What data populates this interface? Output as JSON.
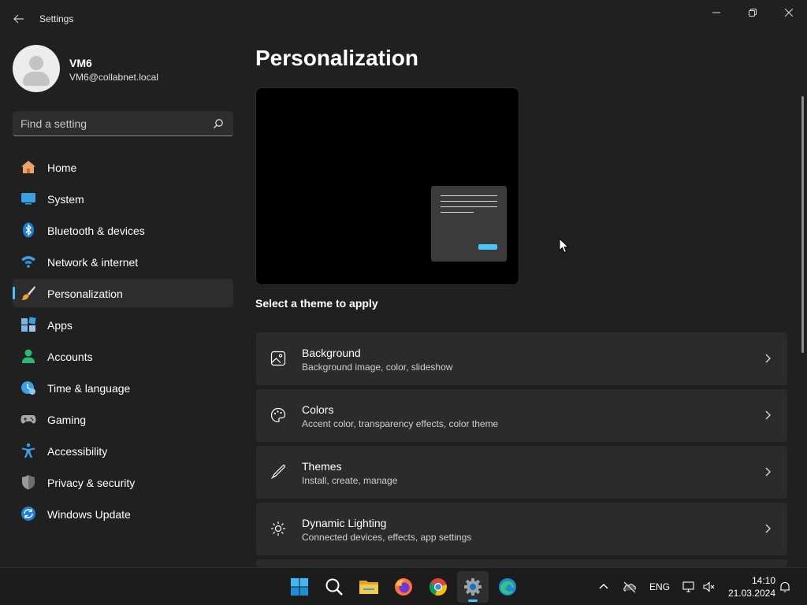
{
  "window": {
    "title": "Settings",
    "controls": {
      "minimize": "minimize-icon",
      "maximize": "restore-icon",
      "close": "close-icon"
    }
  },
  "user": {
    "name": "VM6",
    "email": "VM6@collabnet.local"
  },
  "search": {
    "placeholder": "Find a setting",
    "value": ""
  },
  "sidebar": {
    "items": [
      {
        "label": "Home",
        "icon": "home-icon",
        "active": false
      },
      {
        "label": "System",
        "icon": "system-icon",
        "active": false
      },
      {
        "label": "Bluetooth & devices",
        "icon": "bluetooth-icon",
        "active": false
      },
      {
        "label": "Network & internet",
        "icon": "network-icon",
        "active": false
      },
      {
        "label": "Personalization",
        "icon": "brush-icon",
        "active": true
      },
      {
        "label": "Apps",
        "icon": "apps-icon",
        "active": false
      },
      {
        "label": "Accounts",
        "icon": "accounts-icon",
        "active": false
      },
      {
        "label": "Time & language",
        "icon": "time-icon",
        "active": false
      },
      {
        "label": "Gaming",
        "icon": "gamepad-icon",
        "active": false
      },
      {
        "label": "Accessibility",
        "icon": "accessibility-icon",
        "active": false
      },
      {
        "label": "Privacy & security",
        "icon": "shield-icon",
        "active": false
      },
      {
        "label": "Windows Update",
        "icon": "update-icon",
        "active": false
      }
    ]
  },
  "main": {
    "title": "Personalization",
    "theme_label": "Select a theme to apply",
    "cards": [
      {
        "title": "Background",
        "subtitle": "Background image, color, slideshow",
        "icon": "image-icon"
      },
      {
        "title": "Colors",
        "subtitle": "Accent color, transparency effects, color theme",
        "icon": "palette-icon"
      },
      {
        "title": "Themes",
        "subtitle": "Install, create, manage",
        "icon": "pen-icon"
      },
      {
        "title": "Dynamic Lighting",
        "subtitle": "Connected devices, effects, app settings",
        "icon": "lighting-icon"
      }
    ]
  },
  "taskbar": {
    "apps": [
      "start-icon",
      "search-icon",
      "file-explorer-icon",
      "firefox-icon",
      "chrome-icon",
      "settings-icon",
      "edge-icon"
    ],
    "tray": {
      "language": "ENG",
      "time": "14:10",
      "date": "21.03.2024"
    }
  },
  "colors": {
    "accent": "#4cc2ff",
    "background": "#202020",
    "card": "#2b2b2b",
    "taskbar": "#1c1c1c"
  }
}
